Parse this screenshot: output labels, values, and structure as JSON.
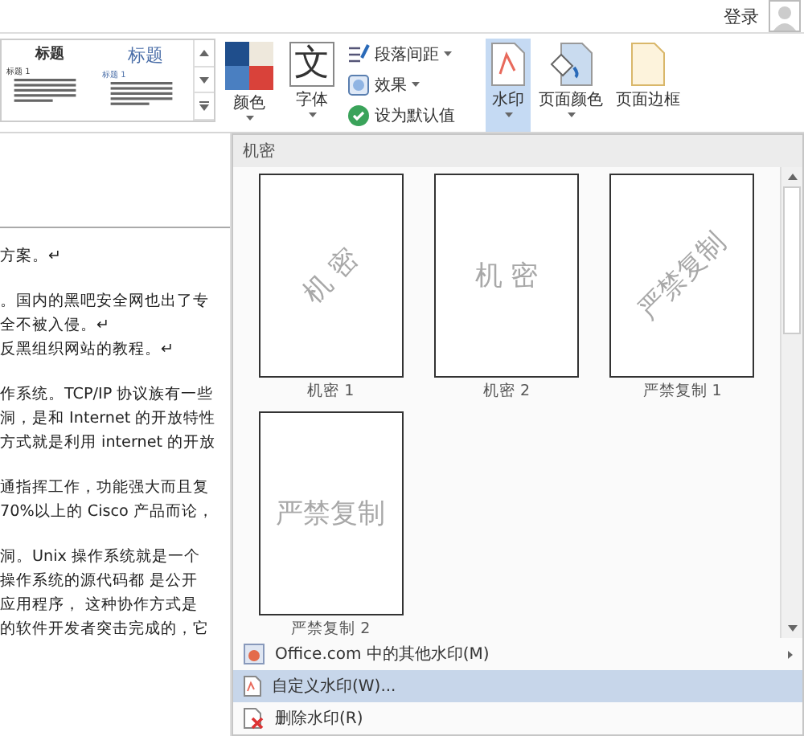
{
  "top_bar": {
    "login": "登录"
  },
  "ribbon": {
    "style_gallery": [
      {
        "title": "标题",
        "heading": "标题 1",
        "kind": "plain"
      },
      {
        "title": "标题",
        "heading": "标题 1",
        "kind": "blue"
      }
    ],
    "buttons": [
      {
        "label": "颜色",
        "kind": "colors",
        "selected": false,
        "dropdown": true
      },
      {
        "label": "字体",
        "kind": "font",
        "glyph": "文",
        "selected": false,
        "dropdown": true
      }
    ],
    "small_buttons": [
      {
        "label": "段落间距",
        "kind": "spacing",
        "dropdown": true
      },
      {
        "label": "效果",
        "kind": "effects",
        "dropdown": true
      },
      {
        "label": "设为默认值",
        "kind": "default",
        "dropdown": false
      }
    ],
    "page_buttons": [
      {
        "label": "水印",
        "kind": "watermark",
        "selected": true,
        "dropdown": true
      },
      {
        "label": "页面颜色",
        "kind": "pagecolor",
        "selected": false,
        "dropdown": true
      },
      {
        "label": "页面边框",
        "kind": "border",
        "selected": false,
        "dropdown": false
      }
    ]
  },
  "document": {
    "paragraphs": [
      {
        "lines": [
          "方案。↵"
        ]
      },
      {
        "lines": [
          "。国内的黑吧安全网也出了专",
          "全不被入侵。↵",
          "反黑组织网站的教程。↵"
        ]
      },
      {
        "lines": [
          "作系统。TCP/IP 协议族有一些",
          "洞，是和 Internet 的开放特性",
          "方式就是利用 internet 的开放"
        ]
      },
      {
        "lines": [
          "通指挥工作，功能强大而且复",
          "70%以上的 Cisco 产品而论，"
        ]
      },
      {
        "lines": [
          "洞。Unix 操作系统就是一个",
          "操作系统的源代码都 是公开",
          "应用程序， 这种协作方式是",
          "的软件开发者突击完成的，它"
        ]
      }
    ]
  },
  "watermark_menu": {
    "section": "机密",
    "items": [
      {
        "label": "机密 1",
        "mark": "机 密",
        "kind": "diagonal"
      },
      {
        "label": "机密 2",
        "mark": "机 密",
        "kind": "horizontal"
      },
      {
        "label": "严禁复制 1",
        "mark": "严禁复制",
        "kind": "diagonal"
      },
      {
        "label": "严禁复制 2",
        "mark": "严禁复制",
        "kind": "horizontal"
      }
    ],
    "commands": [
      {
        "label": "Office.com 中的其他水印(M)",
        "kind": "online",
        "submenu": true,
        "selected": false
      },
      {
        "label": "自定义水印(W)...",
        "kind": "custom",
        "submenu": false,
        "selected": true
      },
      {
        "label": "删除水印(R)",
        "kind": "remove",
        "submenu": false,
        "selected": false
      }
    ]
  }
}
